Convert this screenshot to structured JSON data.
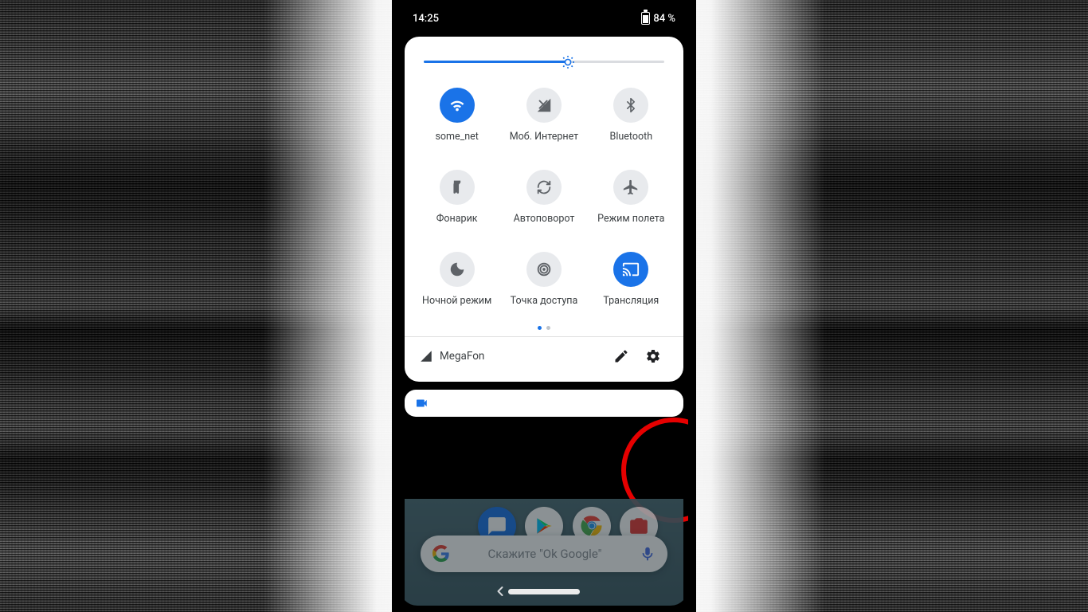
{
  "statusbar": {
    "time": "14:25",
    "battery": "84 %"
  },
  "brightness": {
    "percent": 60
  },
  "tiles": [
    {
      "id": "wifi",
      "label": "some_net",
      "active": true
    },
    {
      "id": "mobiledata",
      "label": "Моб. Интернет",
      "active": false
    },
    {
      "id": "bluetooth",
      "label": "Bluetooth",
      "active": false
    },
    {
      "id": "flashlight",
      "label": "Фонарик",
      "active": false
    },
    {
      "id": "autorotate",
      "label": "Автоповорот",
      "active": false
    },
    {
      "id": "airplane",
      "label": "Режим полета",
      "active": false
    },
    {
      "id": "nightmode",
      "label": "Ночной режим",
      "active": false
    },
    {
      "id": "hotspot",
      "label": "Точка доступа",
      "active": false
    },
    {
      "id": "cast",
      "label": "Трансляция",
      "active": true
    }
  ],
  "pager": {
    "pages": 2,
    "active": 1
  },
  "footer": {
    "carrier": "MegaFon"
  },
  "search": {
    "hint": "Скажите \"Ok Google\""
  },
  "annotation": {
    "circle_highlight": "edit-and-settings"
  },
  "colors": {
    "accent": "#1a73e8",
    "annotation": "#e60000"
  }
}
